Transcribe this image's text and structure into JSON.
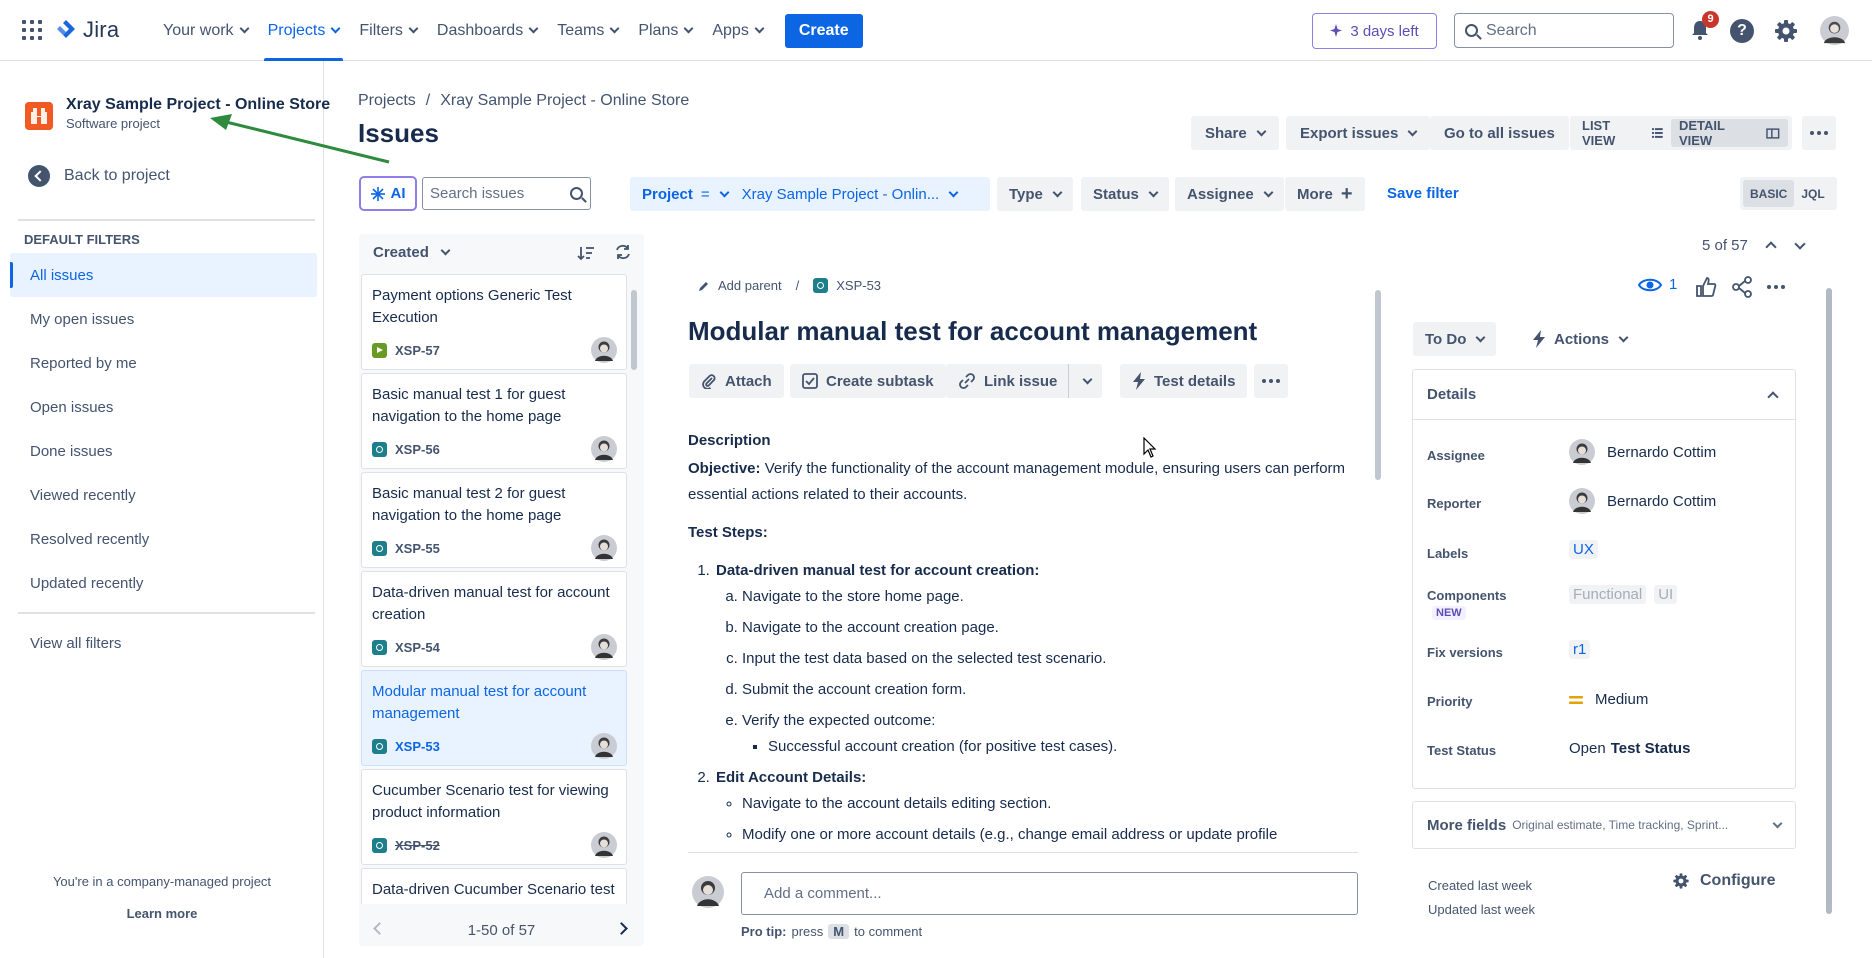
{
  "nav": {
    "logo": "Jira",
    "items": [
      {
        "label": "Your work"
      },
      {
        "label": "Projects"
      },
      {
        "label": "Filters"
      },
      {
        "label": "Dashboards"
      },
      {
        "label": "Teams"
      },
      {
        "label": "Plans"
      },
      {
        "label": "Apps"
      }
    ],
    "create": "Create",
    "trial": "3 days left",
    "search_placeholder": "Search",
    "notifications_count": "9",
    "help": "?"
  },
  "sidebar": {
    "project_name": "Xray Sample Project - Online Store",
    "project_type": "Software project",
    "back": "Back to project",
    "section": "DEFAULT FILTERS",
    "items": [
      {
        "label": "All issues"
      },
      {
        "label": "My open issues"
      },
      {
        "label": "Reported by me"
      },
      {
        "label": "Open issues"
      },
      {
        "label": "Done issues"
      },
      {
        "label": "Viewed recently"
      },
      {
        "label": "Resolved recently"
      },
      {
        "label": "Updated recently"
      }
    ],
    "view_all": "View all filters",
    "company_note": "You're in a company-managed project",
    "learn_more": "Learn more"
  },
  "header": {
    "breadcrumb": [
      "Projects",
      "/",
      "Xray Sample Project - Online Store"
    ],
    "title": "Issues",
    "share": "Share",
    "export": "Export issues",
    "go_all": "Go to all issues",
    "list_view": "LIST VIEW",
    "detail_view": "DETAIL VIEW"
  },
  "filters": {
    "ai": "AI",
    "search_placeholder": "Search issues",
    "project_label": "Project",
    "project_op": "=",
    "project_value": "Xray Sample Project - Onlin...",
    "type": "Type",
    "status": "Status",
    "assignee": "Assignee",
    "more": "More",
    "save": "Save filter",
    "basic": "BASIC",
    "jql": "JQL"
  },
  "list": {
    "sort": "Created",
    "cards": [
      {
        "title": "Payment options Generic Test Execution",
        "key": "XSP-57"
      },
      {
        "title": "Basic manual test 1 for guest navigation to the home page",
        "key": "XSP-56"
      },
      {
        "title": "Basic manual test 2 for guest navigation to the home page",
        "key": "XSP-55"
      },
      {
        "title": "Data-driven manual test for account creation",
        "key": "XSP-54"
      },
      {
        "title": "Modular manual test for account management",
        "key": "XSP-53"
      },
      {
        "title": "Cucumber Scenario test for viewing product information",
        "key": "XSP-52"
      },
      {
        "title": "Data-driven Cucumber Scenario test for viewing product information",
        "key": ""
      }
    ],
    "pager": "1-50 of 57"
  },
  "detail": {
    "counter": "5 of 57",
    "add_parent": "Add parent",
    "key": "XSP-53",
    "title": "Modular manual test for account management",
    "attach": "Attach",
    "subtask": "Create subtask",
    "link": "Link issue",
    "test_details": "Test details",
    "description_label": "Description",
    "objective_label": "Objective:",
    "objective_text": "Verify the functionality of the account management module, ensuring users can perform essential actions related to their accounts.",
    "steps_label": "Test Steps:",
    "step1_title": "Data-driven manual test for account creation:",
    "step1_items": [
      "Navigate to the store home page.",
      "Navigate to the account creation page.",
      "Input the test data based on the selected test scenario.",
      "Submit the account creation form.",
      "Verify the expected outcome:"
    ],
    "step1_sub": "Successful account creation (for positive test cases).",
    "step2_title": "Edit Account Details:",
    "step2_items": [
      "Navigate to the account details editing section.",
      "Modify one or more account details (e.g., change email address or update profile"
    ],
    "comment_placeholder": "Add a comment...",
    "protip_a": "Pro tip:",
    "protip_b": "press",
    "protip_key": "M",
    "protip_c": "to comment"
  },
  "right": {
    "watchers": "1",
    "status": "To Do",
    "actions": "Actions",
    "details": "Details",
    "fields": {
      "assignee_label": "Assignee",
      "assignee": "Bernardo Cottim",
      "reporter_label": "Reporter",
      "reporter": "Bernardo Cottim",
      "labels_label": "Labels",
      "labels": "UX",
      "components_label": "Components",
      "comp1": "Functional",
      "comp2": "UI",
      "new": "NEW",
      "fix_label": "Fix versions",
      "fix": "r1",
      "priority_label": "Priority",
      "priority": "Medium",
      "test_status_label": "Test Status",
      "test_status_a": "Open",
      "test_status_b": "Test Status"
    },
    "more_fields": "More fields",
    "more_fields_hint": "Original estimate, Time tracking, Sprint...",
    "created": "Created last week",
    "updated": "Updated last week",
    "configure": "Configure"
  },
  "colors": {
    "brand": "#0c66e4",
    "project_icon": "#f15a22",
    "annotation_arrow": "#2e8b3e"
  }
}
